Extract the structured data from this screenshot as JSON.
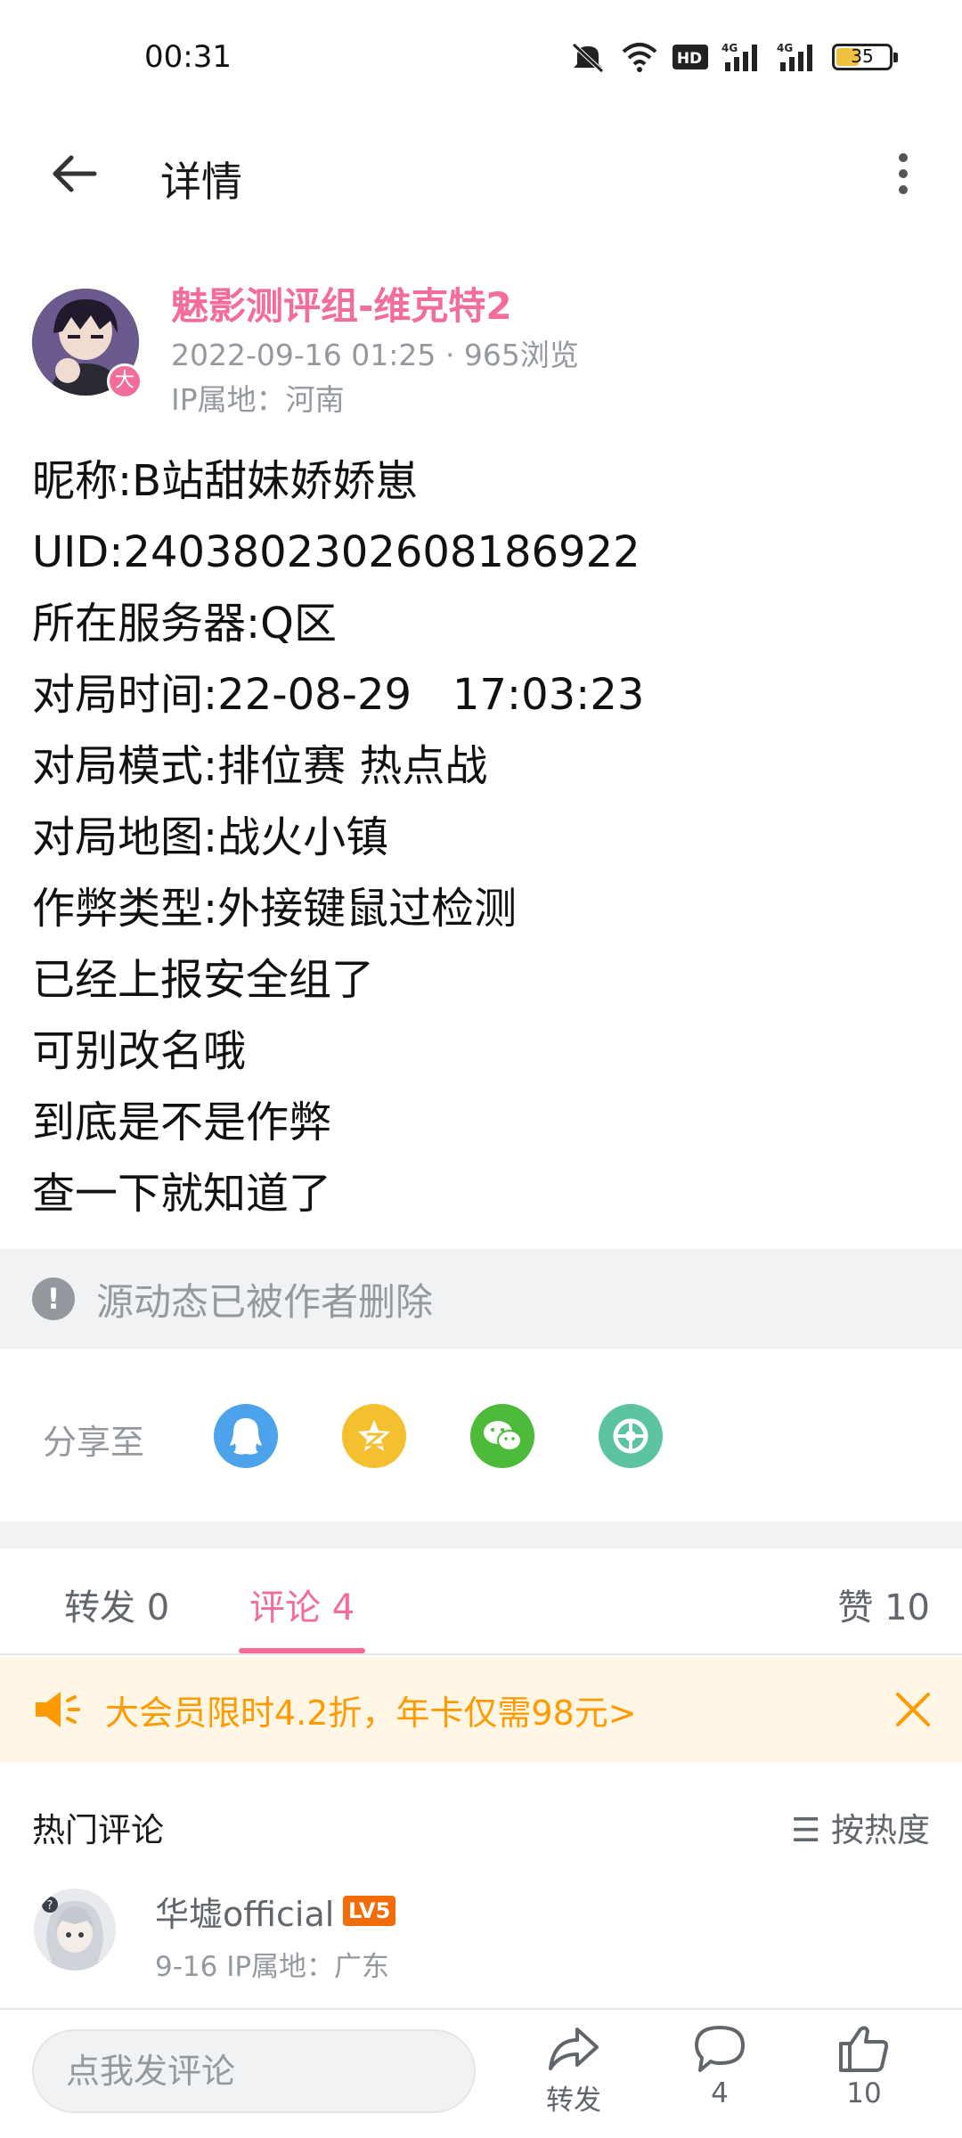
{
  "status_bar": {
    "time": "00:31",
    "battery": "35"
  },
  "header": {
    "title": "详情"
  },
  "author": {
    "name": "魅影测评组-维克特2",
    "meta": "2022-09-16 01:25 · 965浏览",
    "ip": "IP属地：河南",
    "vip_badge": "大"
  },
  "post": {
    "lines": [
      "昵称:B站甜妹娇娇崽",
      "UID:2403802302608186922",
      "所在服务器:Q区",
      "对局时间:22-08-29   17:03:23",
      "对局模式:排位赛 热点战",
      "对局地图:战火小镇",
      "作弊类型:外接键鼠过检测",
      "已经上报安全组了",
      "可别改名哦",
      "到底是不是作弊",
      "查一下就知道了"
    ]
  },
  "deleted_source": {
    "icon": "!",
    "text": "源动态已被作者删除"
  },
  "share": {
    "label": "分享至",
    "targets": [
      {
        "name": "qq-icon",
        "color": "#4ca3ec"
      },
      {
        "name": "qzone-icon",
        "color": "#f5c030"
      },
      {
        "name": "wechat-icon",
        "color": "#4dbb39"
      },
      {
        "name": "moments-icon",
        "color": "#5bc3a0"
      }
    ]
  },
  "tabs": [
    {
      "label": "转发 0",
      "active": false
    },
    {
      "label": "评论 4",
      "active": true
    },
    {
      "label": "赞 10",
      "active": false
    }
  ],
  "promo": {
    "text": "大会员限时4.2折，年卡仅需98元>"
  },
  "comments": {
    "hot_title": "热门评论",
    "sort_label": "☰ 按热度",
    "items": [
      {
        "user": "华墟official",
        "level": "LV5",
        "meta": "9-16  IP属地：广东"
      }
    ]
  },
  "bottom_bar": {
    "input_placeholder": "点我发评论",
    "share_label": "转发",
    "comment_count": "4",
    "like_count": "10"
  },
  "colors": {
    "accent": "#f26d9a",
    "promo": "#ff9a00",
    "muted": "#9499a0"
  }
}
